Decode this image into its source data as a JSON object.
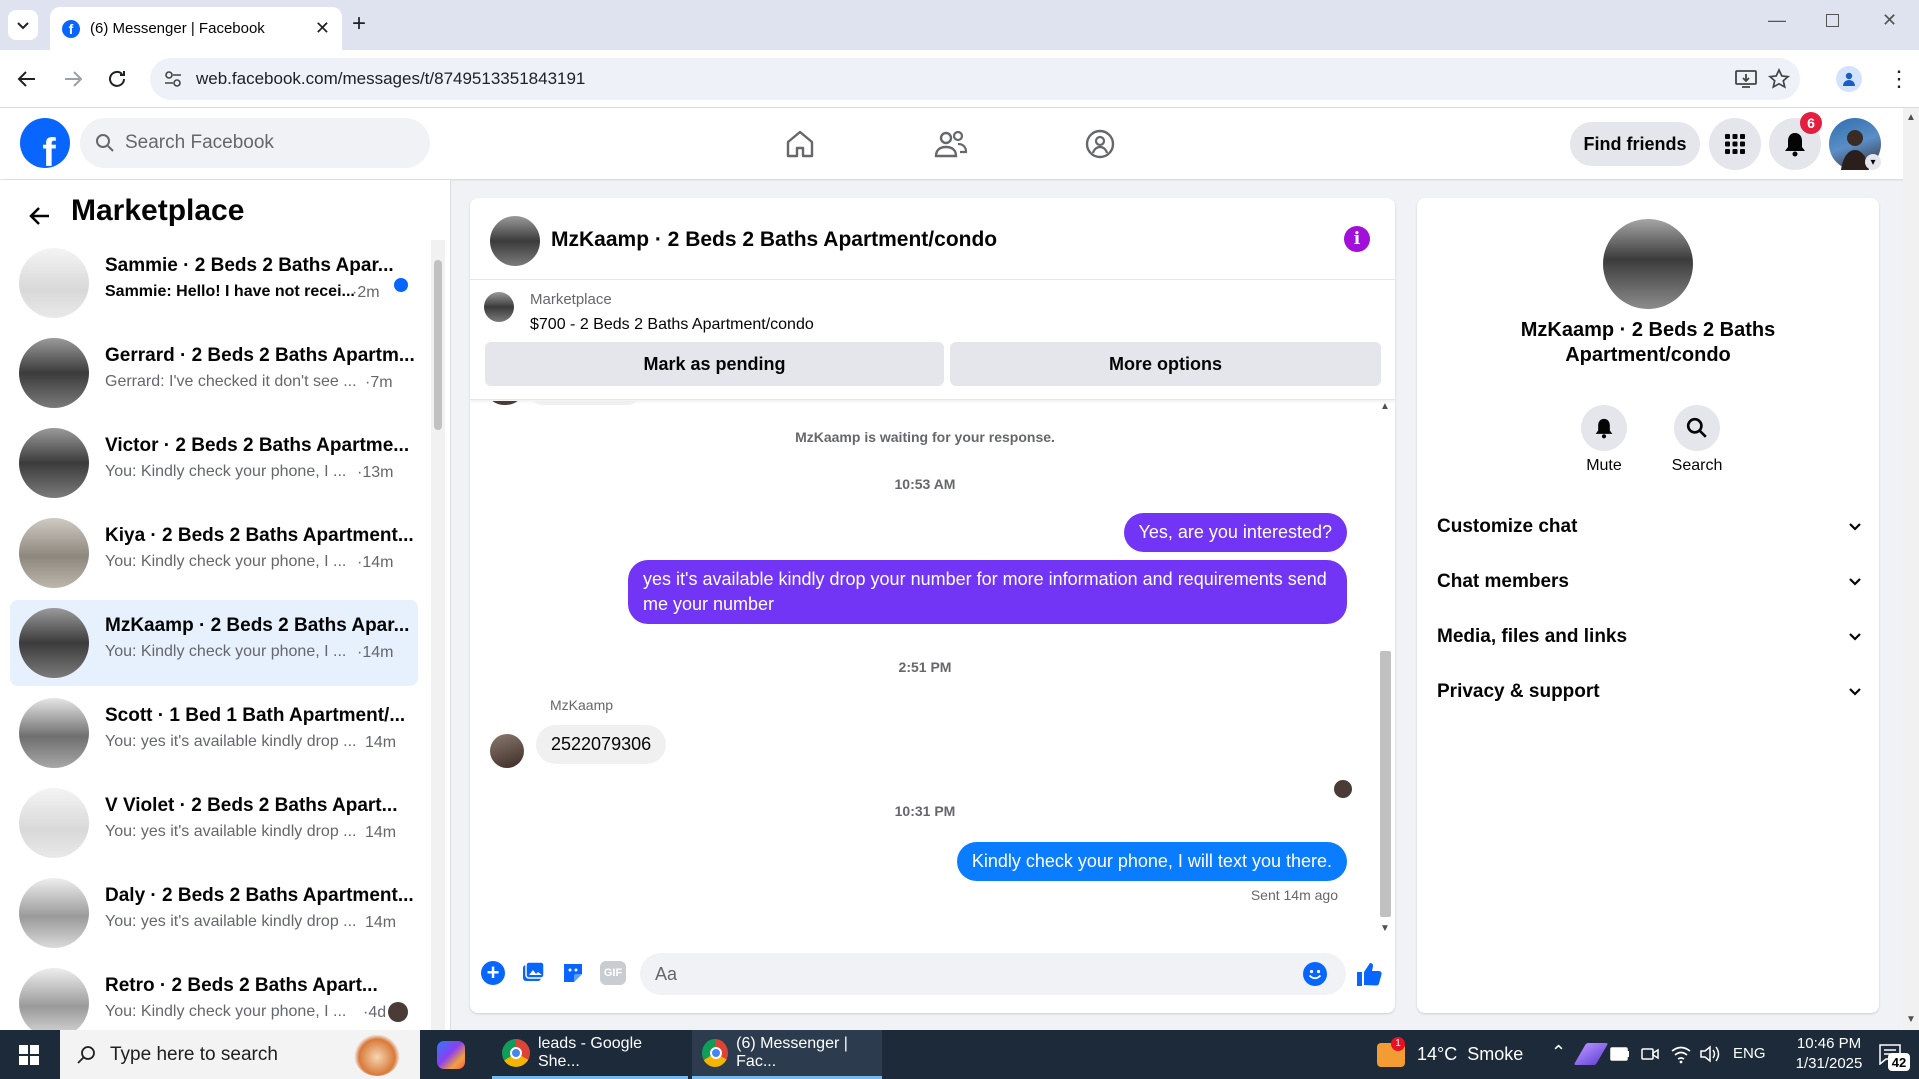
{
  "browser": {
    "tab_title": "(6) Messenger | Facebook",
    "url": "web.facebook.com/messages/t/8749513351843191"
  },
  "header": {
    "search_placeholder": "Search Facebook",
    "find_friends": "Find friends",
    "notifications_count": "6"
  },
  "sidebar": {
    "title": "Marketplace",
    "conversations": [
      {
        "title": "Sammie · 2 Beds 2 Baths Apar...",
        "snippet": "Sammie: Hello! I have not recei...",
        "time": "·2m",
        "unread": true
      },
      {
        "title": "Gerrard · 2 Beds 2 Baths Apartm...",
        "snippet": "Gerrard: I've checked it don't see ...",
        "time": "·7m"
      },
      {
        "title": "Victor · 2 Beds 2 Baths Apartme...",
        "snippet": "You: Kindly check your phone, I ...",
        "time": "·13m"
      },
      {
        "title": "Kiya · 2 Beds 2 Baths Apartment...",
        "snippet": "You: Kindly check your phone, I ...",
        "time": "·14m"
      },
      {
        "title": "MzKaamp · 2 Beds 2 Baths Apar...",
        "snippet": "You: Kindly check your phone, I ...",
        "time": "·14m",
        "active": true
      },
      {
        "title": "Scott · 1 Bed 1 Bath Apartment/...",
        "snippet": "You: yes it's available kindly drop ...",
        "time": "14m"
      },
      {
        "title": "V Violet · 2 Beds 2 Baths Apart...",
        "snippet": "You: yes it's available kindly drop ...",
        "time": "14m"
      },
      {
        "title": "Daly · 2 Beds 2 Baths Apartment...",
        "snippet": "You: yes it's available kindly drop ...",
        "time": "14m"
      },
      {
        "title": "Retro · 2 Beds 2 Baths Apart...",
        "snippet": "You: Kindly check your phone, I ...",
        "time": "·4d"
      }
    ]
  },
  "chat": {
    "title": "MzKaamp · 2 Beds 2 Baths Apartment/condo",
    "listing_label": "Marketplace",
    "listing_title": "$700 - 2 Beds 2 Baths Apartment/condo",
    "mark_pending": "Mark as pending",
    "more_options": "More options",
    "waiting_notice": "MzKaamp is waiting for your response.",
    "time1": "10:53 AM",
    "msg1": "Yes, are you interested?",
    "msg2": "yes it's available kindly drop your number for more information and requirements send me your number",
    "time2": "2:51 PM",
    "sender": "MzKaamp",
    "msg3": "2522079306",
    "time3": "10:31 PM",
    "msg4": "Kindly check your phone, I will text you there.",
    "sent_status": "Sent 14m ago",
    "composer_placeholder": "Aa"
  },
  "info_panel": {
    "name": "MzKaamp · 2 Beds 2 Baths Apartment/condo",
    "mute": "Mute",
    "search": "Search",
    "sections": [
      "Customize chat",
      "Chat members",
      "Media, files and links",
      "Privacy & support"
    ]
  },
  "taskbar": {
    "search_placeholder": "Type here to search",
    "app1": "leads - Google She...",
    "app2": "(6) Messenger | Fac...",
    "weather": "14°C  Smoke",
    "lang": "ENG",
    "time": "10:46 PM",
    "date": "1/31/2025",
    "notif_count": "42"
  },
  "colors": {
    "accent": "#7234f5",
    "fb_blue": "#0866ff",
    "active_bg": "#e7f0fd"
  }
}
